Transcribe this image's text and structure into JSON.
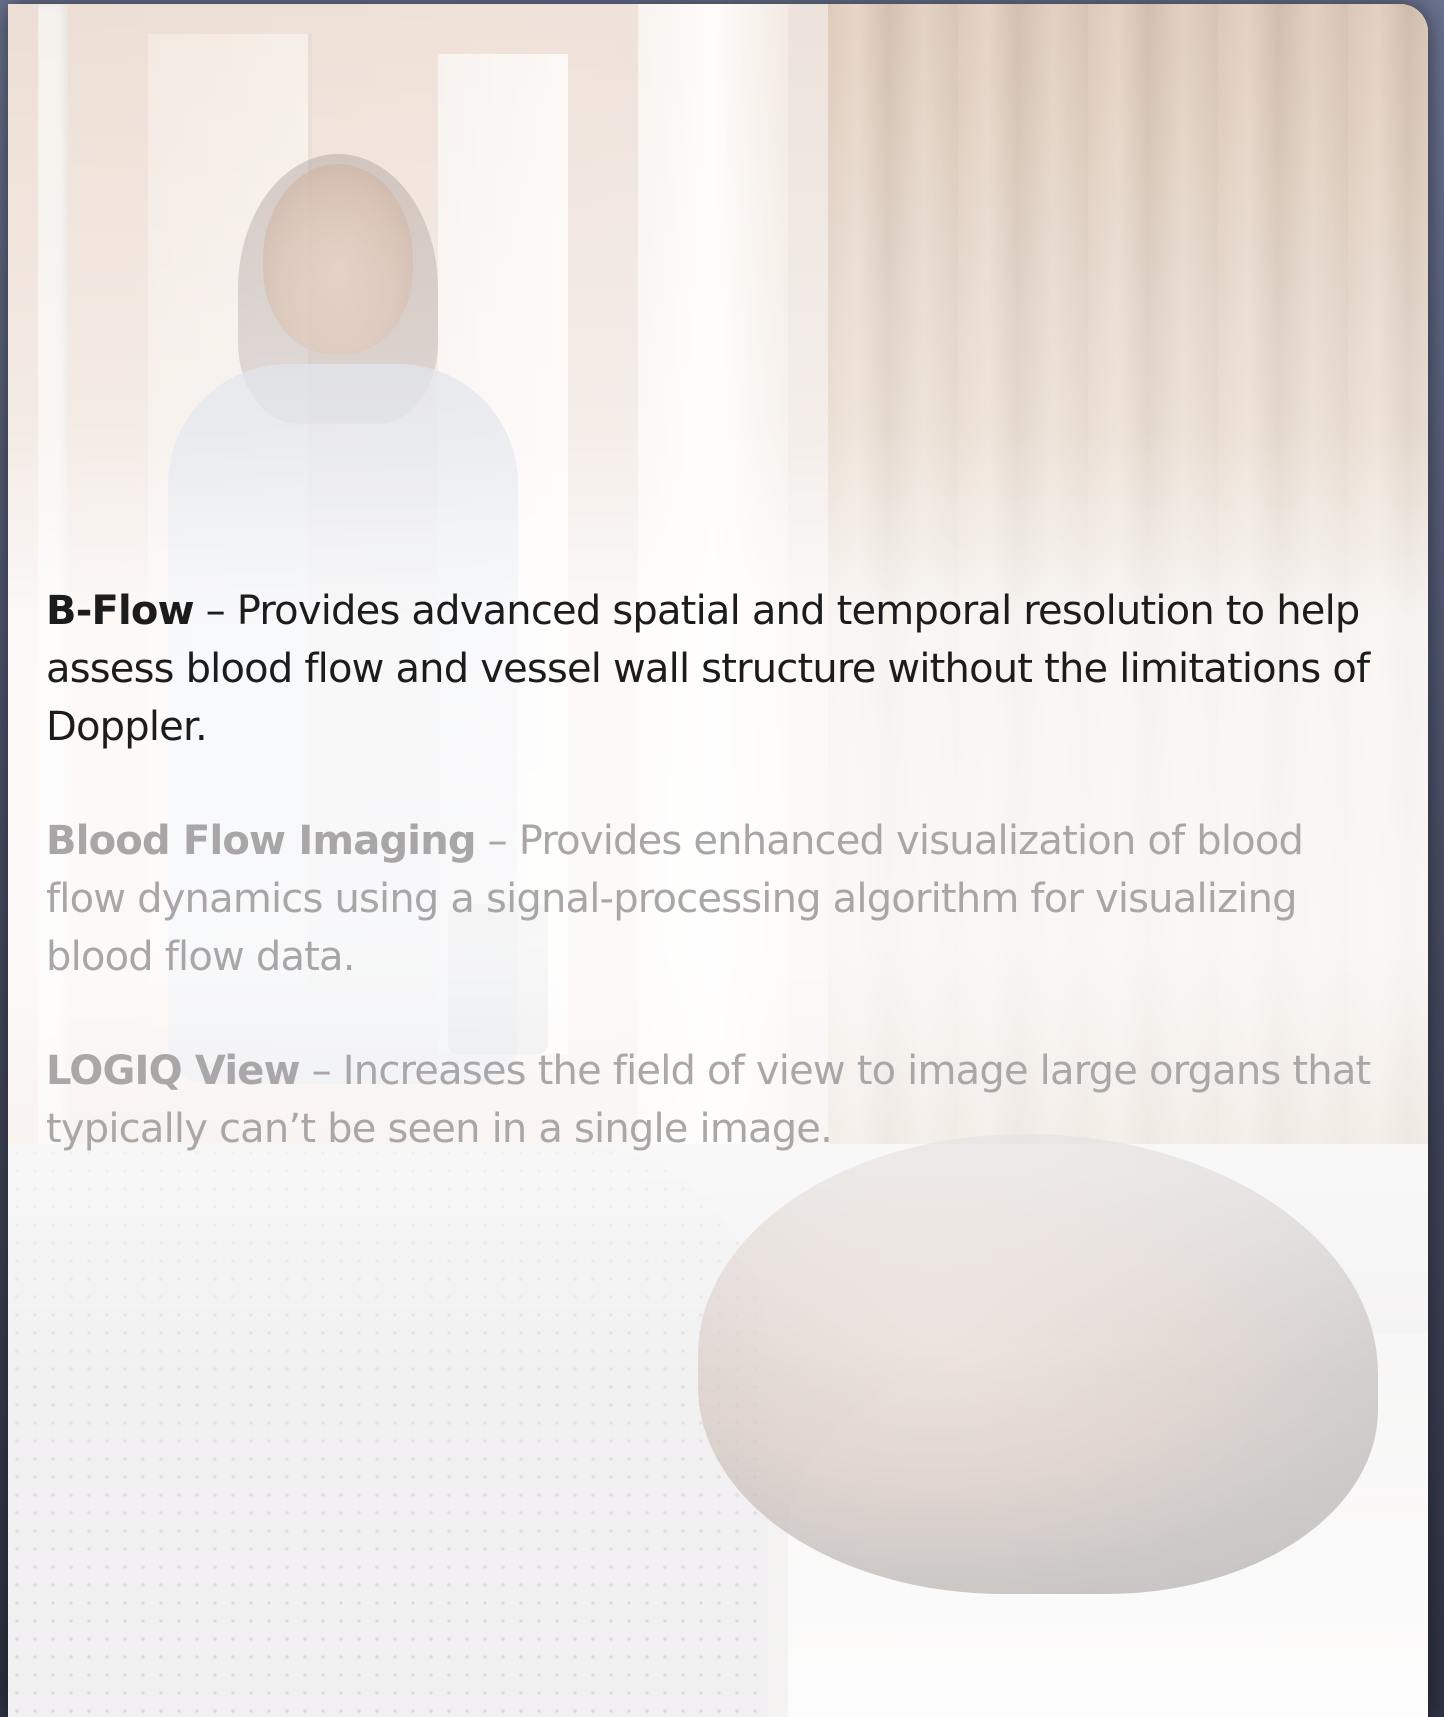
{
  "features": [
    {
      "name": "B-Flow",
      "separator": " – ",
      "description": "Provides advanced spatial and temporal resolution to help assess blood flow and vessel wall structure without the limitations of Doppler."
    },
    {
      "name": "Blood Flow Imaging",
      "separator": " – ",
      "description": "Provides enhanced visualization of blood flow dynamics using a signal-processing algorithm for visualizing blood flow data."
    },
    {
      "name": "LOGIQ View",
      "separator": " – ",
      "description": "Increases the field of view to image large organs that typically can’t be seen in a single image."
    }
  ],
  "colors": {
    "active_text": "#1c1c1c",
    "inactive_text": "#a8a6a6",
    "frame_background": "#474d63"
  }
}
